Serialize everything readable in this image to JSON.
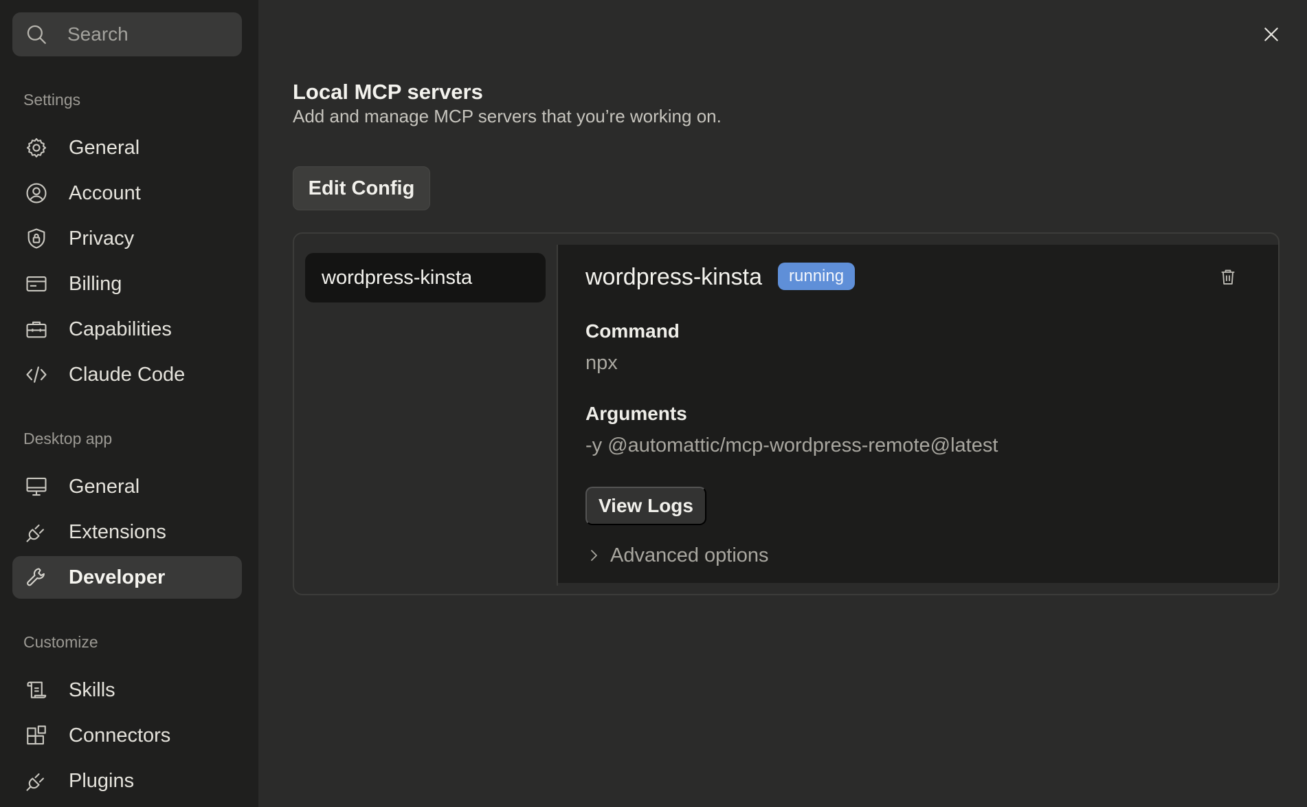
{
  "search": {
    "placeholder": "Search"
  },
  "sidebar": {
    "sections": [
      {
        "label": "Settings",
        "items": [
          {
            "label": "General",
            "icon": "gear-icon"
          },
          {
            "label": "Account",
            "icon": "user-circle-icon"
          },
          {
            "label": "Privacy",
            "icon": "shield-lock-icon"
          },
          {
            "label": "Billing",
            "icon": "credit-card-icon"
          },
          {
            "label": "Capabilities",
            "icon": "briefcase-icon"
          },
          {
            "label": "Claude Code",
            "icon": "code-icon"
          }
        ]
      },
      {
        "label": "Desktop app",
        "items": [
          {
            "label": "General",
            "icon": "monitor-icon"
          },
          {
            "label": "Extensions",
            "icon": "plug-icon"
          },
          {
            "label": "Developer",
            "icon": "wrench-icon",
            "active": true
          }
        ]
      },
      {
        "label": "Customize",
        "items": [
          {
            "label": "Skills",
            "icon": "scroll-icon"
          },
          {
            "label": "Connectors",
            "icon": "blocks-icon"
          },
          {
            "label": "Plugins",
            "icon": "plug-icon"
          }
        ]
      }
    ]
  },
  "main": {
    "title": "Local MCP servers",
    "subtitle": "Add and manage MCP servers that you’re working on.",
    "edit_config_label": "Edit Config",
    "servers": [
      {
        "name": "wordpress-kinsta",
        "selected": true
      }
    ],
    "detail": {
      "name": "wordpress-kinsta",
      "status": "running",
      "status_color": "#5f8fd8",
      "command_label": "Command",
      "command_value": "npx",
      "arguments_label": "Arguments",
      "arguments_value": "-y @automattic/mcp-wordpress-remote@latest",
      "view_logs_label": "View Logs",
      "advanced_label": "Advanced options"
    }
  }
}
